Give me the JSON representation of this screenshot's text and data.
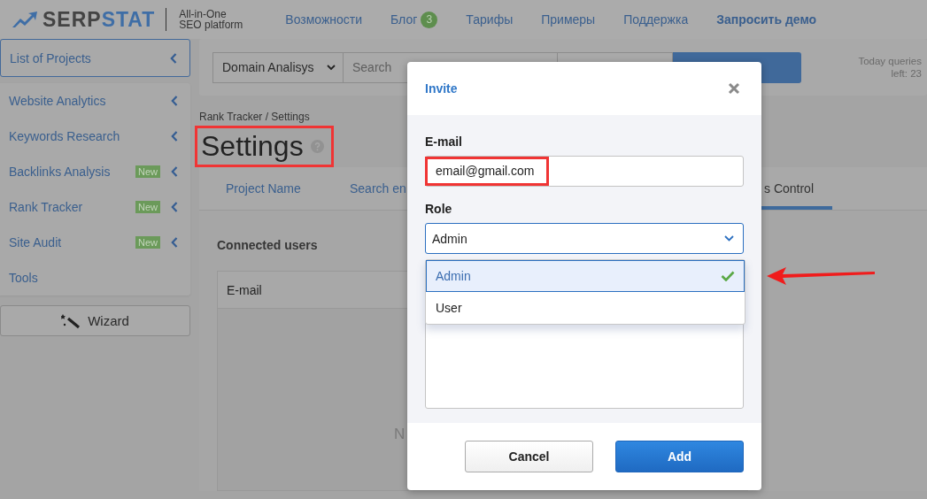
{
  "header": {
    "logo": "SERPSTAT",
    "tagline": [
      "All-in-One",
      "SEO platform"
    ],
    "nav": [
      {
        "label": "Возможности",
        "kind": "link"
      },
      {
        "label": "Блог",
        "kind": "link",
        "badge": "3"
      },
      {
        "label": "Тарифы",
        "kind": "link"
      },
      {
        "label": "Примеры",
        "kind": "link"
      },
      {
        "label": "Поддержка",
        "kind": "link"
      },
      {
        "label": "Запросить демо",
        "kind": "cta"
      }
    ]
  },
  "sidebar": {
    "top": "List of Projects",
    "items": [
      {
        "label": "Website Analytics",
        "expandable": true
      },
      {
        "label": "Keywords Research",
        "expandable": true
      },
      {
        "label": "Backlinks Analysis",
        "badge": "New",
        "expandable": true
      },
      {
        "label": "Rank Tracker",
        "badge": "New",
        "expandable": true
      },
      {
        "label": "Site Audit",
        "badge": "New",
        "expandable": true
      },
      {
        "label": "Tools",
        "expandable": false
      }
    ],
    "wizard": "Wizard"
  },
  "search": {
    "mode": "Domain Analisys",
    "placeholder": "Search",
    "queries": [
      "Today queries",
      "left: 23"
    ]
  },
  "breadcrumb": "Rank Tracker / Settings",
  "title": {
    "text": "Settings",
    "highlighted": true
  },
  "tabs": [
    {
      "label": "Project Name",
      "selected": false
    },
    {
      "label": "Search en",
      "selected": false
    },
    {
      "label": "s Control",
      "selected": true
    }
  ],
  "section_title": "Connected users",
  "table": {
    "columns": [
      "E-mail"
    ],
    "empty_text": "N"
  },
  "modal": {
    "title": "Invite",
    "email_label": "E-mail",
    "email_value": "email@gmail.com",
    "email_highlighted": true,
    "role_label": "Role",
    "role_value": "Admin",
    "options": [
      {
        "label": "Admin",
        "selected": true
      },
      {
        "label": "User",
        "selected": false
      }
    ],
    "buttons": [
      {
        "label": "Cancel",
        "kind": "secondary"
      },
      {
        "label": "Add",
        "kind": "primary"
      }
    ]
  },
  "annotations": [
    {
      "kind": "arrow"
    }
  ]
}
